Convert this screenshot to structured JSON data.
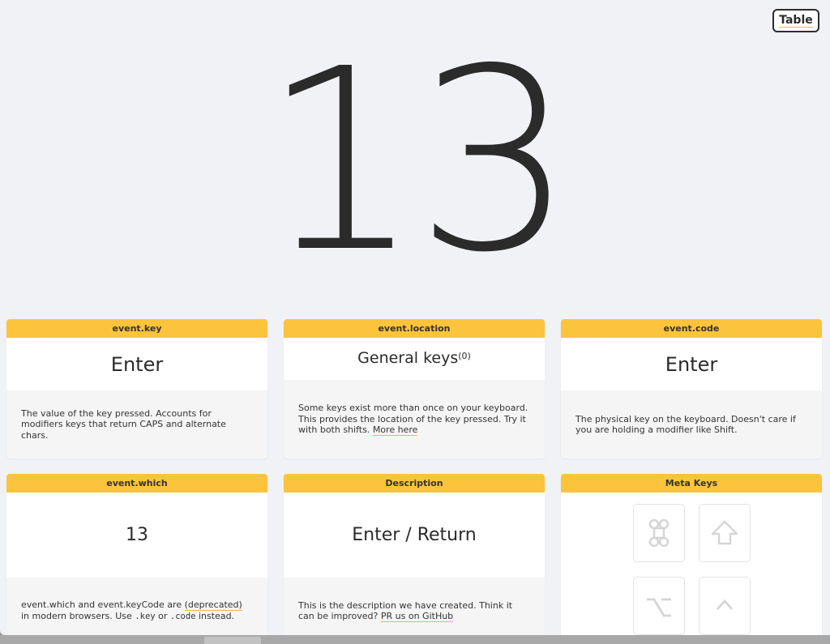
{
  "toolbar": {
    "table_button": "Table"
  },
  "key_display": {
    "code": "13"
  },
  "cards": {
    "key": {
      "title": "event.key",
      "value": "Enter",
      "description": "The value of the key pressed. Accounts for modifiers keys that return CAPS and alternate chars."
    },
    "location": {
      "title": "event.location",
      "value": "General keys",
      "value_code": "(0)",
      "description": "Some keys exist more than once on your keyboard. This provides the location of the key pressed. Try it with both shifts.",
      "link": "More here"
    },
    "code": {
      "title": "event.code",
      "value": "Enter",
      "description": "The physical key on the keyboard. Doesn't care if you are holding a modifier like Shift."
    },
    "which": {
      "title": "event.which",
      "value": "13",
      "desc_part1": "event.which and event.keyCode are",
      "desc_deprecated": "(deprecated)",
      "desc_part2": "in modern browsers. Use",
      "desc_code1": ".key",
      "desc_or": "or",
      "desc_code2": ".code",
      "desc_part3": "instead."
    },
    "description": {
      "title": "Description",
      "value": "Enter / Return",
      "description": "This is the description we have created. Think it can be improved?",
      "link": "PR us on GitHub"
    },
    "meta": {
      "title": "Meta Keys",
      "keys": [
        "command-icon",
        "shift-icon",
        "option-icon",
        "control-icon"
      ]
    }
  }
}
